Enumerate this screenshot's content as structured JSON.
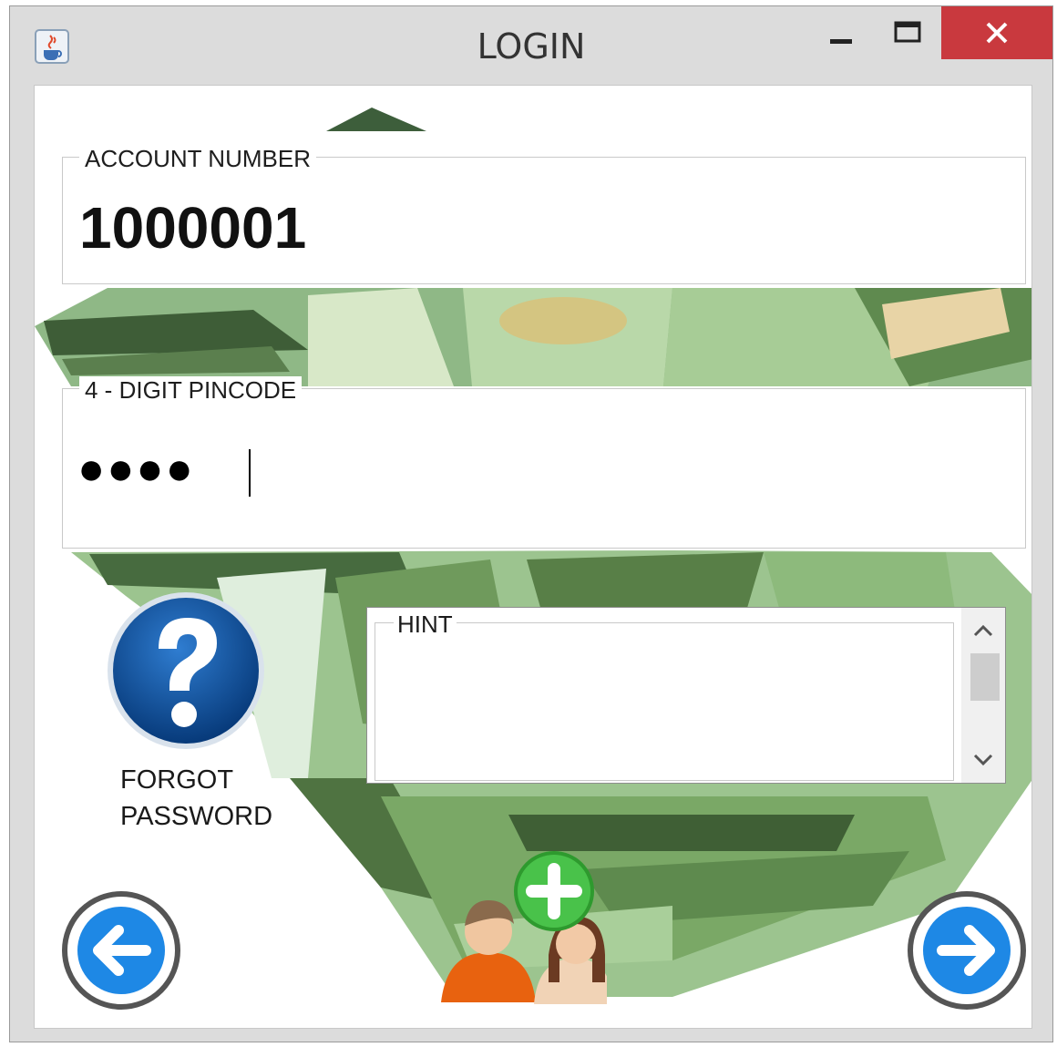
{
  "window": {
    "title": "LOGIN",
    "app_icon": "java-cup-icon",
    "controls": [
      "minimize-icon",
      "maximize-icon",
      "close-icon"
    ],
    "close_color": "#c9393e"
  },
  "form": {
    "account_number": {
      "label": "ACCOUNT NUMBER",
      "value": "1000001"
    },
    "pincode": {
      "label": "4 - DIGIT PINCODE",
      "masked_value": "●●●●"
    },
    "forgot": {
      "icon": "question-mark-icon",
      "line1": "FORGOT",
      "line2": "PASSWORD"
    },
    "hint": {
      "label": "HINT",
      "value": ""
    }
  },
  "navigation": {
    "back_icon": "arrow-left-icon",
    "next_icon": "arrow-right-icon",
    "add_user_icon": "add-user-icon"
  },
  "colors": {
    "accent_blue": "#1e88e5",
    "money_green": "#6f9a5c",
    "add_green": "#3fb33f",
    "help_blue": "#0d4c97"
  }
}
